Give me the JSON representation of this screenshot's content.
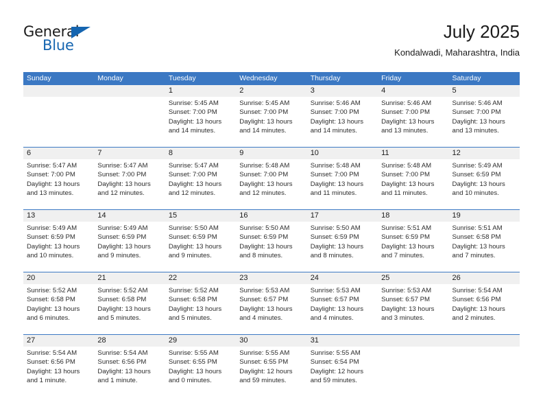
{
  "logo": {
    "word_top": "General",
    "word_bottom": "Blue",
    "triangle_icon": "blue-triangle-icon",
    "accent_color": "#1565b0"
  },
  "header": {
    "month_title": "July 2025",
    "location": "Kondalwadi, Maharashtra, India"
  },
  "theme": {
    "header_blue": "#3b78c3",
    "day_band_gray": "#f0f0f0",
    "text_dark": "#1b1b1b"
  },
  "calendar": {
    "weekday_headers": [
      "Sunday",
      "Monday",
      "Tuesday",
      "Wednesday",
      "Thursday",
      "Friday",
      "Saturday"
    ],
    "weeks": [
      {
        "days": [
          {
            "num": "",
            "lines": []
          },
          {
            "num": "",
            "lines": []
          },
          {
            "num": "1",
            "lines": [
              "Sunrise: 5:45 AM",
              "Sunset: 7:00 PM",
              "Daylight: 13 hours",
              "and 14 minutes."
            ]
          },
          {
            "num": "2",
            "lines": [
              "Sunrise: 5:45 AM",
              "Sunset: 7:00 PM",
              "Daylight: 13 hours",
              "and 14 minutes."
            ]
          },
          {
            "num": "3",
            "lines": [
              "Sunrise: 5:46 AM",
              "Sunset: 7:00 PM",
              "Daylight: 13 hours",
              "and 14 minutes."
            ]
          },
          {
            "num": "4",
            "lines": [
              "Sunrise: 5:46 AM",
              "Sunset: 7:00 PM",
              "Daylight: 13 hours",
              "and 13 minutes."
            ]
          },
          {
            "num": "5",
            "lines": [
              "Sunrise: 5:46 AM",
              "Sunset: 7:00 PM",
              "Daylight: 13 hours",
              "and 13 minutes."
            ]
          }
        ]
      },
      {
        "days": [
          {
            "num": "6",
            "lines": [
              "Sunrise: 5:47 AM",
              "Sunset: 7:00 PM",
              "Daylight: 13 hours",
              "and 13 minutes."
            ]
          },
          {
            "num": "7",
            "lines": [
              "Sunrise: 5:47 AM",
              "Sunset: 7:00 PM",
              "Daylight: 13 hours",
              "and 12 minutes."
            ]
          },
          {
            "num": "8",
            "lines": [
              "Sunrise: 5:47 AM",
              "Sunset: 7:00 PM",
              "Daylight: 13 hours",
              "and 12 minutes."
            ]
          },
          {
            "num": "9",
            "lines": [
              "Sunrise: 5:48 AM",
              "Sunset: 7:00 PM",
              "Daylight: 13 hours",
              "and 12 minutes."
            ]
          },
          {
            "num": "10",
            "lines": [
              "Sunrise: 5:48 AM",
              "Sunset: 7:00 PM",
              "Daylight: 13 hours",
              "and 11 minutes."
            ]
          },
          {
            "num": "11",
            "lines": [
              "Sunrise: 5:48 AM",
              "Sunset: 7:00 PM",
              "Daylight: 13 hours",
              "and 11 minutes."
            ]
          },
          {
            "num": "12",
            "lines": [
              "Sunrise: 5:49 AM",
              "Sunset: 6:59 PM",
              "Daylight: 13 hours",
              "and 10 minutes."
            ]
          }
        ]
      },
      {
        "days": [
          {
            "num": "13",
            "lines": [
              "Sunrise: 5:49 AM",
              "Sunset: 6:59 PM",
              "Daylight: 13 hours",
              "and 10 minutes."
            ]
          },
          {
            "num": "14",
            "lines": [
              "Sunrise: 5:49 AM",
              "Sunset: 6:59 PM",
              "Daylight: 13 hours",
              "and 9 minutes."
            ]
          },
          {
            "num": "15",
            "lines": [
              "Sunrise: 5:50 AM",
              "Sunset: 6:59 PM",
              "Daylight: 13 hours",
              "and 9 minutes."
            ]
          },
          {
            "num": "16",
            "lines": [
              "Sunrise: 5:50 AM",
              "Sunset: 6:59 PM",
              "Daylight: 13 hours",
              "and 8 minutes."
            ]
          },
          {
            "num": "17",
            "lines": [
              "Sunrise: 5:50 AM",
              "Sunset: 6:59 PM",
              "Daylight: 13 hours",
              "and 8 minutes."
            ]
          },
          {
            "num": "18",
            "lines": [
              "Sunrise: 5:51 AM",
              "Sunset: 6:59 PM",
              "Daylight: 13 hours",
              "and 7 minutes."
            ]
          },
          {
            "num": "19",
            "lines": [
              "Sunrise: 5:51 AM",
              "Sunset: 6:58 PM",
              "Daylight: 13 hours",
              "and 7 minutes."
            ]
          }
        ]
      },
      {
        "days": [
          {
            "num": "20",
            "lines": [
              "Sunrise: 5:52 AM",
              "Sunset: 6:58 PM",
              "Daylight: 13 hours",
              "and 6 minutes."
            ]
          },
          {
            "num": "21",
            "lines": [
              "Sunrise: 5:52 AM",
              "Sunset: 6:58 PM",
              "Daylight: 13 hours",
              "and 5 minutes."
            ]
          },
          {
            "num": "22",
            "lines": [
              "Sunrise: 5:52 AM",
              "Sunset: 6:58 PM",
              "Daylight: 13 hours",
              "and 5 minutes."
            ]
          },
          {
            "num": "23",
            "lines": [
              "Sunrise: 5:53 AM",
              "Sunset: 6:57 PM",
              "Daylight: 13 hours",
              "and 4 minutes."
            ]
          },
          {
            "num": "24",
            "lines": [
              "Sunrise: 5:53 AM",
              "Sunset: 6:57 PM",
              "Daylight: 13 hours",
              "and 4 minutes."
            ]
          },
          {
            "num": "25",
            "lines": [
              "Sunrise: 5:53 AM",
              "Sunset: 6:57 PM",
              "Daylight: 13 hours",
              "and 3 minutes."
            ]
          },
          {
            "num": "26",
            "lines": [
              "Sunrise: 5:54 AM",
              "Sunset: 6:56 PM",
              "Daylight: 13 hours",
              "and 2 minutes."
            ]
          }
        ]
      },
      {
        "days": [
          {
            "num": "27",
            "lines": [
              "Sunrise: 5:54 AM",
              "Sunset: 6:56 PM",
              "Daylight: 13 hours",
              "and 1 minute."
            ]
          },
          {
            "num": "28",
            "lines": [
              "Sunrise: 5:54 AM",
              "Sunset: 6:56 PM",
              "Daylight: 13 hours",
              "and 1 minute."
            ]
          },
          {
            "num": "29",
            "lines": [
              "Sunrise: 5:55 AM",
              "Sunset: 6:55 PM",
              "Daylight: 13 hours",
              "and 0 minutes."
            ]
          },
          {
            "num": "30",
            "lines": [
              "Sunrise: 5:55 AM",
              "Sunset: 6:55 PM",
              "Daylight: 12 hours",
              "and 59 minutes."
            ]
          },
          {
            "num": "31",
            "lines": [
              "Sunrise: 5:55 AM",
              "Sunset: 6:54 PM",
              "Daylight: 12 hours",
              "and 59 minutes."
            ]
          },
          {
            "num": "",
            "lines": []
          },
          {
            "num": "",
            "lines": []
          }
        ]
      }
    ]
  }
}
